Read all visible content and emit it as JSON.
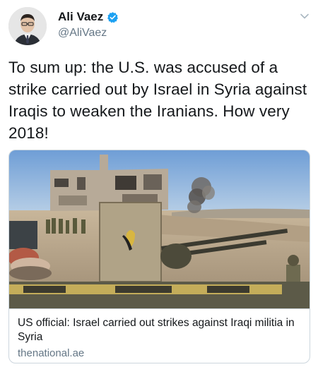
{
  "author": {
    "display_name": "Ali Vaez",
    "handle": "@AliVaez",
    "verified": true
  },
  "tweet": {
    "text": "To sum up: the U.S. was accused of a strike carried out by Israel in Syria against Iraqis to weaken the Iranians. How very 2018!"
  },
  "card": {
    "title": "US official: Israel carried out strikes against Iraqi militia in Syria",
    "domain": "thenational.ae"
  },
  "colors": {
    "verified_blue": "#1da1f2",
    "secondary_text": "#657786",
    "border": "#ccd6dd"
  }
}
